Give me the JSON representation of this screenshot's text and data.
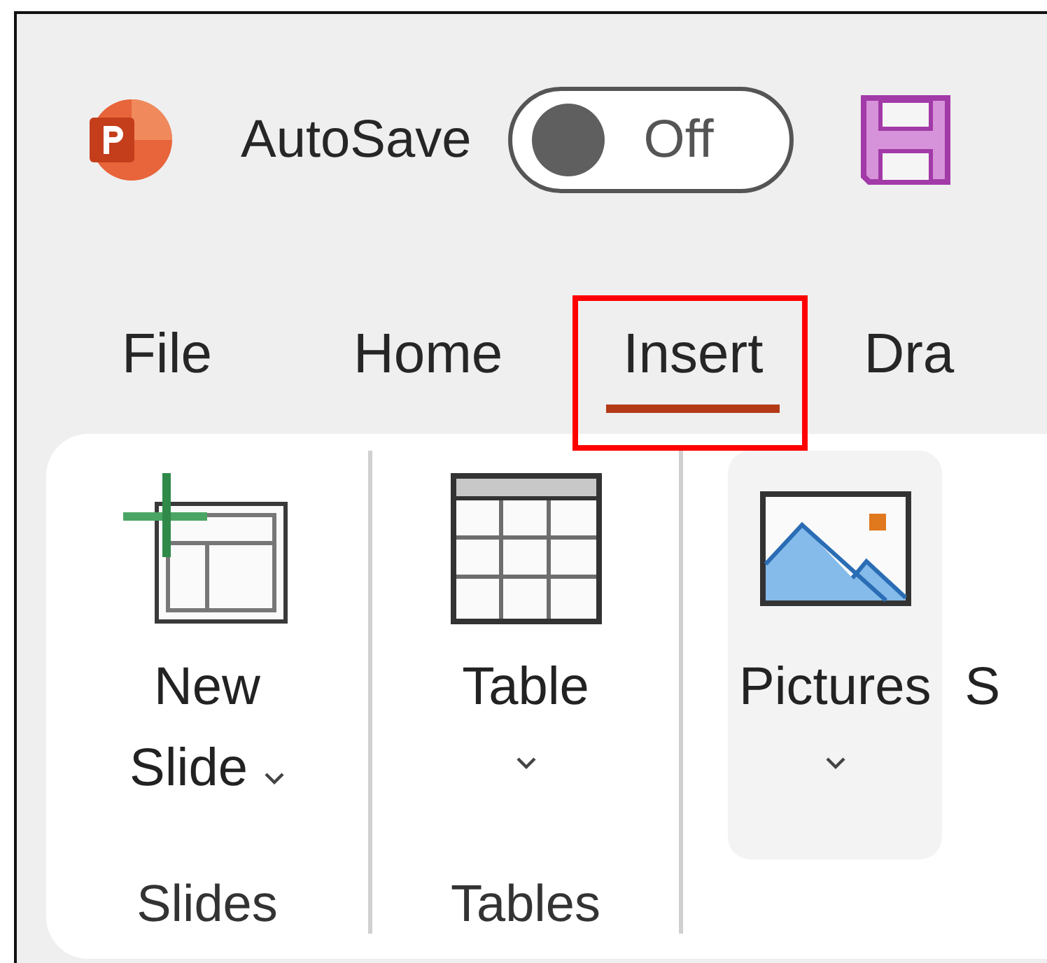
{
  "title_bar": {
    "autosave": {
      "label": "AutoSave",
      "on": false,
      "state_text": "Off"
    }
  },
  "tabs": [
    {
      "label": "File",
      "selected": false,
      "highlighted": false
    },
    {
      "label": "Home",
      "selected": false,
      "highlighted": false
    },
    {
      "label": "Insert",
      "selected": true,
      "highlighted": true
    },
    {
      "label": "Dra",
      "selected": false,
      "highlighted": false
    }
  ],
  "ribbon": {
    "groups": [
      {
        "label": "Slides",
        "buttons": [
          {
            "label": "New Slide",
            "kind": "newslide",
            "dropdown": true,
            "hovered": false
          }
        ]
      },
      {
        "label": "Tables",
        "buttons": [
          {
            "label": "Table",
            "kind": "table",
            "dropdown": true,
            "hovered": false
          }
        ]
      },
      {
        "buttons": [
          {
            "label": "Pictures",
            "kind": "pictures",
            "dropdown": true,
            "hovered": true
          },
          {
            "label": "S",
            "kind": "plain",
            "dropdown": false,
            "hovered": false
          }
        ]
      }
    ]
  }
}
